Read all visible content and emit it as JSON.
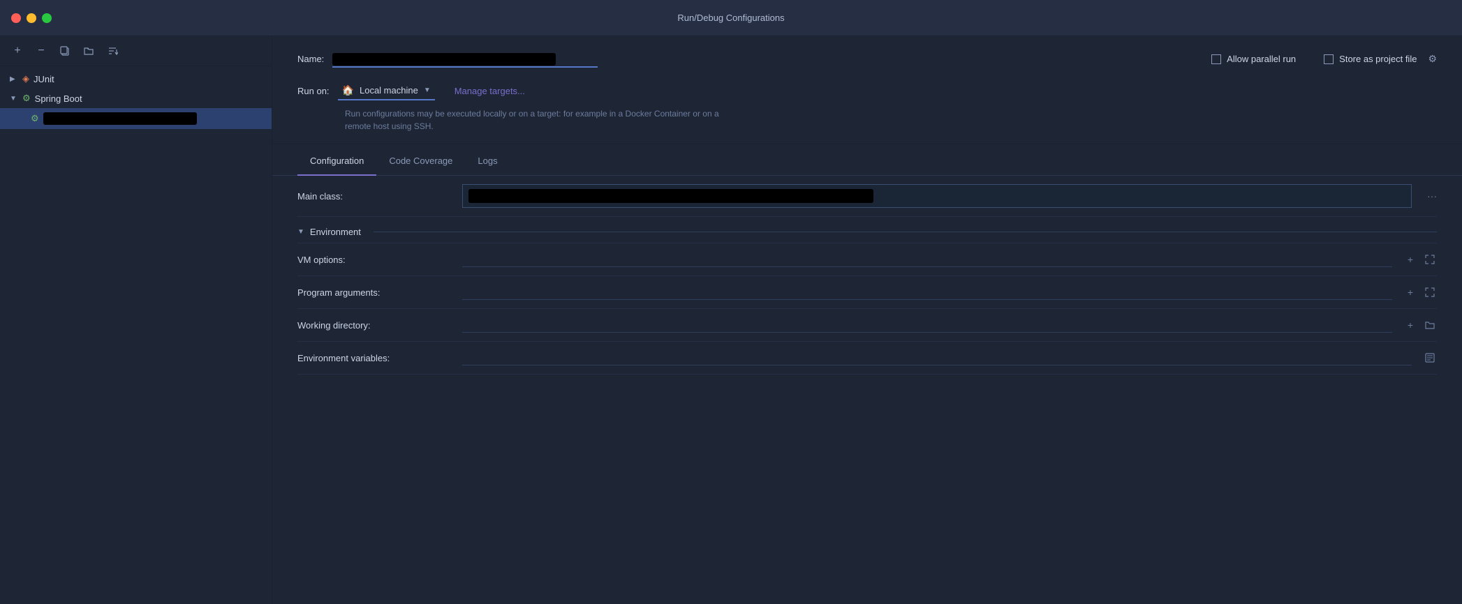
{
  "window": {
    "title": "Run/Debug Configurations"
  },
  "toolbar": {
    "add_label": "+",
    "remove_label": "−",
    "copy_label": "⧉",
    "folder_label": "📁",
    "sort_label": "↕"
  },
  "tree": {
    "junit_label": "JUnit",
    "springboot_label": "Spring Boot",
    "child_redacted": true
  },
  "config": {
    "name_label": "Name:",
    "name_value": "",
    "allow_parallel_label": "Allow parallel run",
    "store_as_project_label": "Store as project file",
    "run_on_label": "Run on:",
    "local_machine_label": "Local machine",
    "manage_targets_label": "Manage targets...",
    "hint_text": "Run configurations may be executed locally or on a target: for example in a Docker Container or on a remote host using SSH."
  },
  "tabs": [
    {
      "label": "Configuration",
      "active": true
    },
    {
      "label": "Code Coverage",
      "active": false
    },
    {
      "label": "Logs",
      "active": false
    }
  ],
  "fields": {
    "main_class_label": "Main class:",
    "environment_label": "Environment",
    "vm_options_label": "VM options:",
    "program_args_label": "Program arguments:",
    "working_dir_label": "Working directory:",
    "env_vars_label": "Environment variables:"
  }
}
